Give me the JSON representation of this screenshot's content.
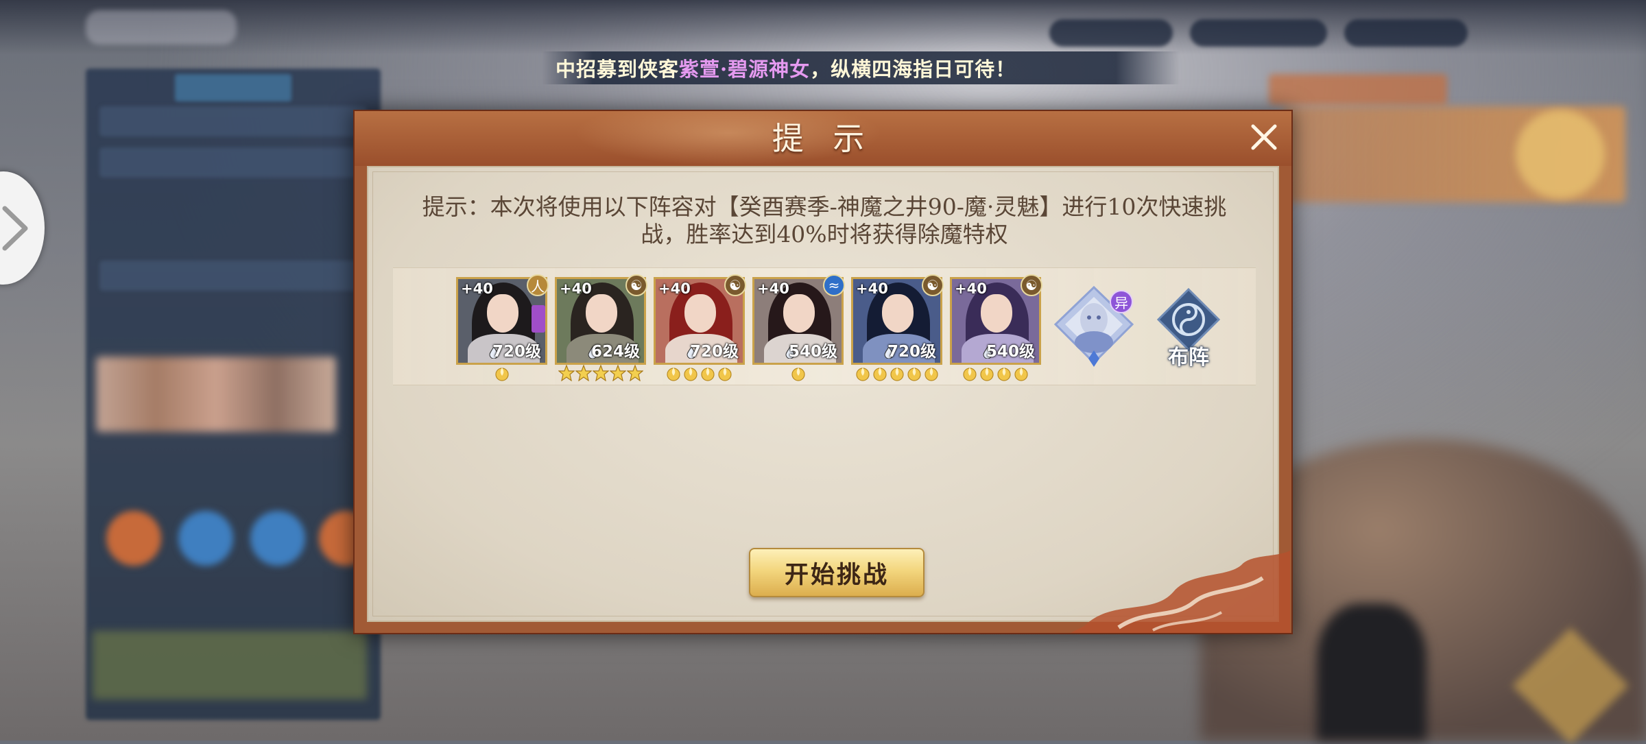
{
  "marquee": {
    "prefix": "中招募到侠客",
    "highlight": "紫萱·碧源神女",
    "suffix": "，纵横四海指日可待！"
  },
  "dialog": {
    "title": "提 示",
    "tip": "提示：本次将使用以下阵容对【癸酉赛季-神魔之井90-魔·灵魅】进行10次快速挑战，胜率达到40%时将获得除魔特权",
    "start_button": "开始挑战",
    "formation_label": "布阵"
  },
  "heroes": [
    {
      "plus": "+40",
      "level": "720级",
      "stars": 1,
      "badge": "human-badge-icon"
    },
    {
      "plus": "+40",
      "level": "624级",
      "stars": 5,
      "badge": "yinyang-badge-icon"
    },
    {
      "plus": "+40",
      "level": "720级",
      "stars": 4,
      "badge": "yinyang-badge-icon"
    },
    {
      "plus": "+40",
      "level": "540级",
      "stars": 1,
      "badge": "water-badge-icon"
    },
    {
      "plus": "+40",
      "level": "720级",
      "stars": 5,
      "badge": "yinyang-badge-icon"
    },
    {
      "plus": "+40",
      "level": "540级",
      "stars": 4,
      "badge": "yinyang-badge-icon"
    }
  ],
  "pet": {
    "tag": "异"
  },
  "colors": {
    "frame": "#a15a35",
    "parchment": "#e5dccb",
    "gold": "#caa24a",
    "highlight_text": "#e59af0"
  }
}
